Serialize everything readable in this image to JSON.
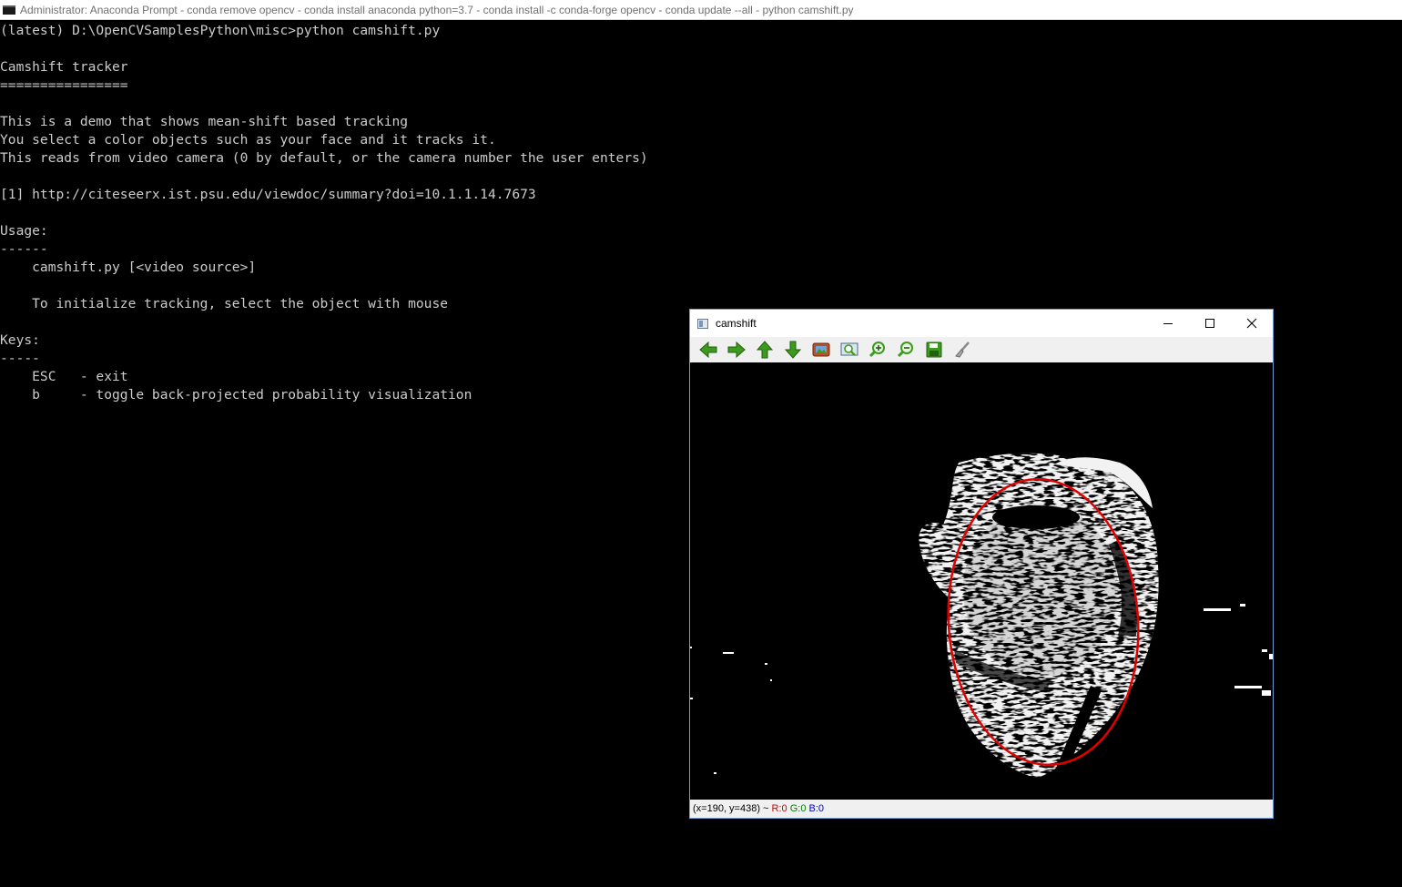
{
  "console_window": {
    "title": "Administrator: Anaconda Prompt - conda  remove opencv - conda  install anaconda python=3.7  - conda  install -c conda-forge opencv - conda  update --all - python  camshift.py",
    "lines": [
      "(latest) D:\\OpenCVSamplesPython\\misc>python camshift.py",
      "",
      "Camshift tracker",
      "================",
      "",
      "This is a demo that shows mean-shift based tracking",
      "You select a color objects such as your face and it tracks it.",
      "This reads from video camera (0 by default, or the camera number the user enters)",
      "",
      "[1] http://citeseerx.ist.psu.edu/viewdoc/summary?doi=10.1.1.14.7673",
      "",
      "Usage:",
      "------",
      "    camshift.py [<video source>]",
      "",
      "    To initialize tracking, select the object with mouse",
      "",
      "Keys:",
      "-----",
      "    ESC   - exit",
      "    b     - toggle back-projected probability visualization"
    ]
  },
  "cv_window": {
    "title": "camshift",
    "controls": {
      "minimize": "minimize-icon",
      "maximize": "maximize-icon",
      "close": "close-icon"
    },
    "toolbar": [
      {
        "name": "pan-left-button",
        "icon": "arrow-left-icon"
      },
      {
        "name": "pan-right-button",
        "icon": "arrow-right-icon"
      },
      {
        "name": "pan-up-button",
        "icon": "arrow-up-icon"
      },
      {
        "name": "pan-down-button",
        "icon": "arrow-down-icon"
      },
      {
        "name": "zoom-original-button",
        "icon": "image-icon"
      },
      {
        "name": "zoom-fit-button",
        "icon": "zoom-fit-icon"
      },
      {
        "name": "zoom-in-button",
        "icon": "zoom-in-icon"
      },
      {
        "name": "zoom-out-button",
        "icon": "zoom-out-icon"
      },
      {
        "name": "save-button",
        "icon": "save-icon"
      },
      {
        "name": "properties-button",
        "icon": "brush-icon"
      }
    ],
    "status": {
      "coords": "(x=190, y=438) ~",
      "r": "R:0",
      "g": "G:0",
      "b": "B:0"
    },
    "colors": {
      "tracking_ellipse": "#e00000",
      "icon_green": "#3c9a1e"
    }
  }
}
